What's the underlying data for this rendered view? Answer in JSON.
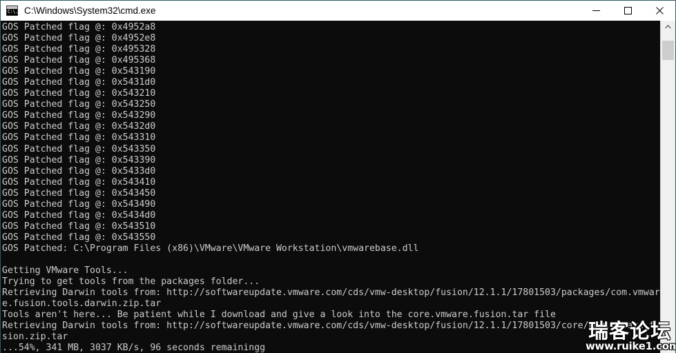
{
  "window": {
    "title": "C:\\Windows\\System32\\cmd.exe",
    "icon": "cmd-icon",
    "icon_glyph": "C:\\.",
    "background_color": "#0c0c0c",
    "foreground_color": "#cccccc",
    "titlebar_color": "#ffffff",
    "border_color": "#2f5b66"
  },
  "controls": {
    "minimize_label": "Minimize",
    "maximize_label": "Maximize",
    "close_label": "Close"
  },
  "scrollbar": {
    "up_arrow": "▲",
    "down_arrow": "▼",
    "thumb_color": "#cdcdcd",
    "track_color": "#f0f0f0"
  },
  "console": {
    "lines": [
      "GOS Patched flag @: 0x4952a8",
      "GOS Patched flag @: 0x4952e8",
      "GOS Patched flag @: 0x495328",
      "GOS Patched flag @: 0x495368",
      "GOS Patched flag @: 0x543190",
      "GOS Patched flag @: 0x5431d0",
      "GOS Patched flag @: 0x543210",
      "GOS Patched flag @: 0x543250",
      "GOS Patched flag @: 0x543290",
      "GOS Patched flag @: 0x5432d0",
      "GOS Patched flag @: 0x543310",
      "GOS Patched flag @: 0x543350",
      "GOS Patched flag @: 0x543390",
      "GOS Patched flag @: 0x5433d0",
      "GOS Patched flag @: 0x543410",
      "GOS Patched flag @: 0x543450",
      "GOS Patched flag @: 0x543490",
      "GOS Patched flag @: 0x5434d0",
      "GOS Patched flag @: 0x543510",
      "GOS Patched flag @: 0x543550",
      "GOS Patched: C:\\Program Files (x86)\\VMware\\VMware Workstation\\vmwarebase.dll",
      "",
      "Getting VMware Tools...",
      "Trying to get tools from the packages folder...",
      "Retrieving Darwin tools from: http://softwareupdate.vmware.com/cds/vmw-desktop/fusion/12.1.1/17801503/packages/com.vmwar",
      "e.fusion.tools.darwin.zip.tar",
      "Tools aren't here... Be patient while I download and give a look into the core.vmware.fusion.tar file",
      "Retrieving Darwin tools from: http://softwareupdate.vmware.com/cds/vmw-desktop/fusion/12.1.1/17801503/core/com.vmware.fu",
      "sion.zip.tar",
      "...54%, 341 MB, 3037 KB/s, 96 seconds remainingg"
    ]
  },
  "watermark": {
    "text_cn": "瑞客论坛",
    "text_url": "www.ruike1.com"
  }
}
